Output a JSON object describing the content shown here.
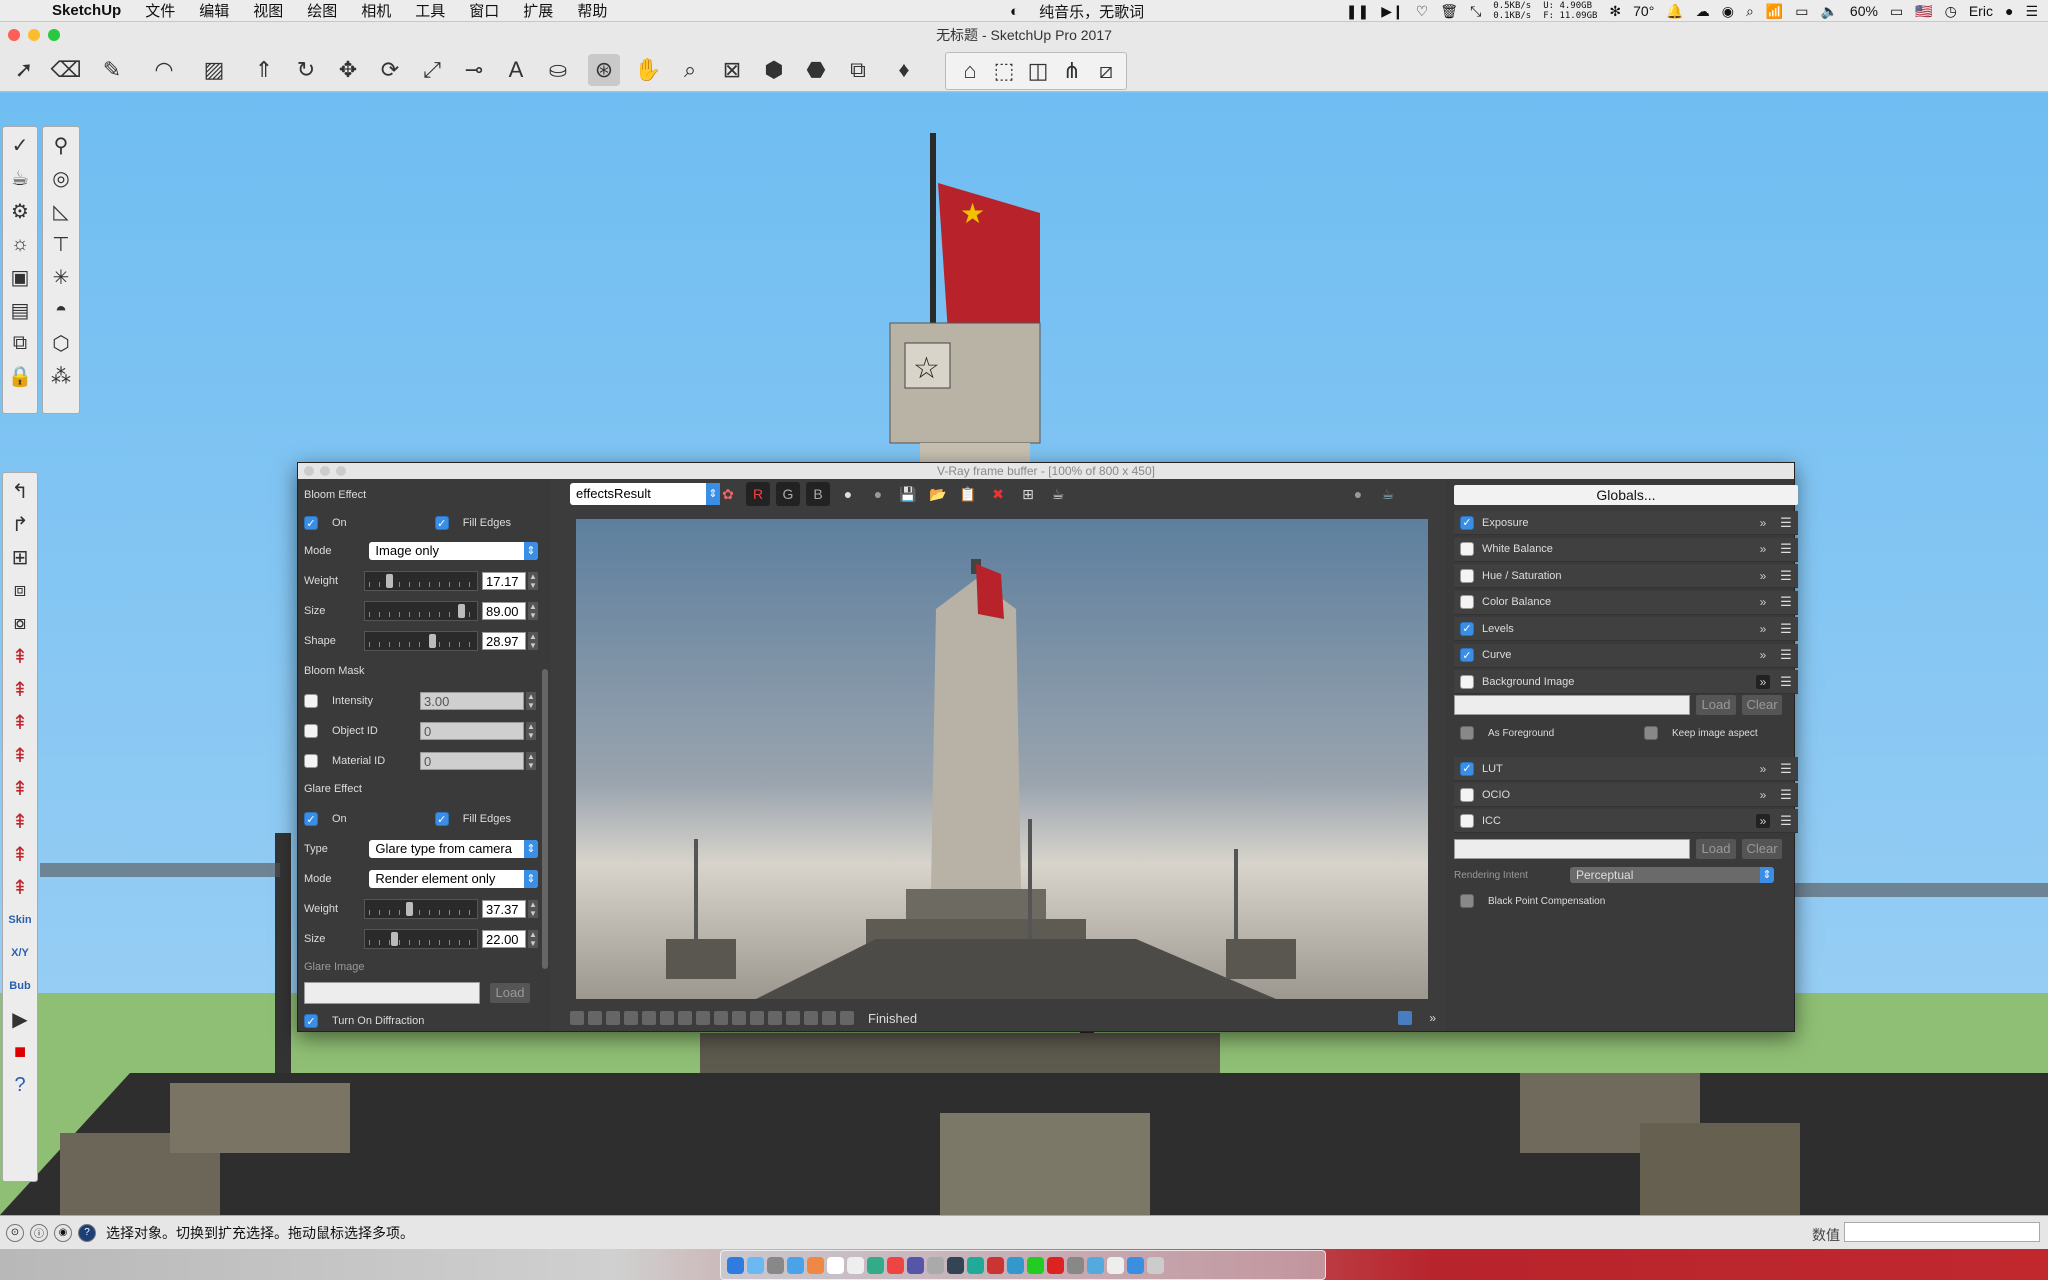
{
  "menubar": {
    "app_name": "SketchUp",
    "items": [
      "文件",
      "编辑",
      "视图",
      "绘图",
      "相机",
      "工具",
      "窗口",
      "扩展",
      "帮助"
    ],
    "now_playing": "纯音乐，无歌词",
    "net_up": "0.5KB/s",
    "net_down": "0.1KB/s",
    "disk_u": "U:  4.90GB",
    "disk_f": "F: 11.09GB",
    "temperature": "70°",
    "battery": "60%",
    "user": "Eric"
  },
  "window": {
    "title": "无标题 - SketchUp Pro 2017"
  },
  "vfb": {
    "title": "V-Ray frame buffer - [100% of 800 x 450]",
    "channel": "effectsResult",
    "status": "Finished",
    "rgb": [
      "R",
      "G",
      "B"
    ],
    "left": {
      "bloom_effect": "Bloom Effect",
      "on": "On",
      "fill_edges": "Fill Edges",
      "mode_label": "Mode",
      "mode_value": "Image only",
      "weight_label": "Weight",
      "weight_value": "17.17",
      "weight_level": 0.17,
      "size_label": "Size",
      "size_value": "89.00",
      "size_level": 0.89,
      "shape_label": "Shape",
      "shape_value": "28.97",
      "shape_level": 0.6,
      "bloom_mask": "Bloom Mask",
      "intensity_label": "Intensity",
      "intensity_value": "3.00",
      "object_id_label": "Object ID",
      "object_id_value": "0",
      "material_id_label": "Material ID",
      "material_id_value": "0",
      "glare_effect": "Glare Effect",
      "glare_on": "On",
      "glare_fill_edges": "Fill Edges",
      "type_label": "Type",
      "type_value": "Glare type from camera",
      "glare_mode_label": "Mode",
      "glare_mode_value": "Render element only",
      "glare_weight_label": "Weight",
      "glare_weight_value": "37.37",
      "glare_weight_level": 0.37,
      "glare_size_label": "Size",
      "glare_size_value": "22.00",
      "glare_size_level": 0.22,
      "glare_image_label": "Glare Image",
      "load": "Load",
      "diffraction": "Turn On Diffraction"
    },
    "right": {
      "globals": "Globals...",
      "layers": [
        {
          "label": "Exposure",
          "checked": true
        },
        {
          "label": "White Balance",
          "checked": false
        },
        {
          "label": "Hue / Saturation",
          "checked": false
        },
        {
          "label": "Color Balance",
          "checked": false
        },
        {
          "label": "Levels",
          "checked": true
        },
        {
          "label": "Curve",
          "checked": true
        },
        {
          "label": "Background Image",
          "checked": false
        }
      ],
      "load": "Load",
      "clear": "Clear",
      "as_foreground": "As Foreground",
      "keep_aspect": "Keep image aspect",
      "lut": "LUT",
      "ocio": "OCIO",
      "icc": "ICC",
      "rendering_intent_label": "Rendering Intent",
      "rendering_intent_value": "Perceptual",
      "black_point": "Black Point Compensation"
    }
  },
  "left_toolbar_labels": {
    "skin": "Skin",
    "xy": "X/Y",
    "bub": "Bub"
  },
  "statusbar": {
    "hint": "选择对象。切换到扩充选择。拖动鼠标选择多项。",
    "value_label": "数值"
  },
  "colors": {
    "accent": "#3a8ee6",
    "sky": "#7cc2f0",
    "flag": "#c0262e"
  }
}
